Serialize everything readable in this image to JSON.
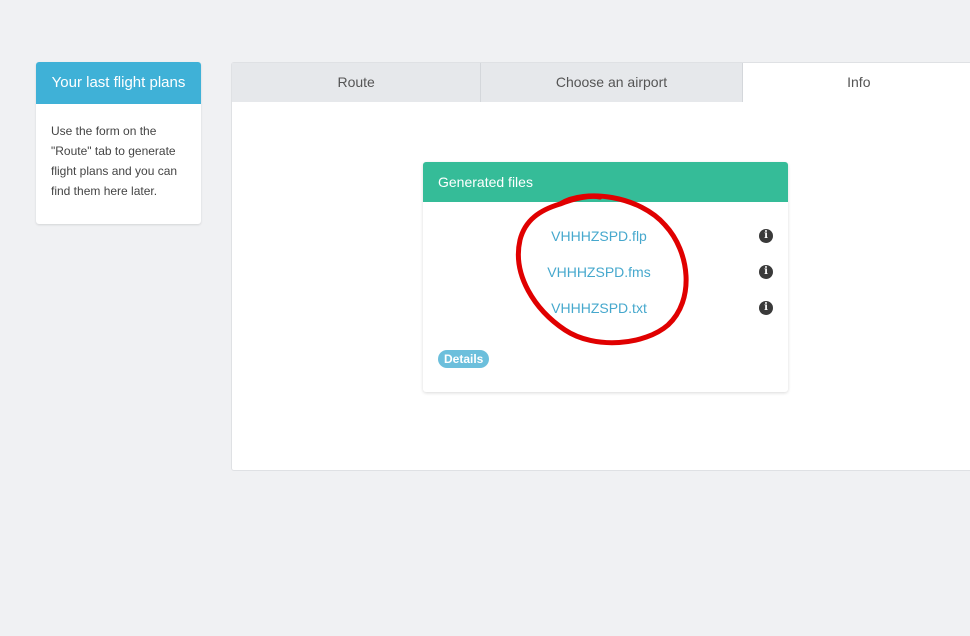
{
  "sidebar": {
    "title": "Your last flight plans",
    "description": "Use the form on the \"Route\" tab to generate flight plans and you can find them here later."
  },
  "tabs": [
    {
      "label": "Route",
      "active": false
    },
    {
      "label": "Choose an airport",
      "active": false
    },
    {
      "label": "Info",
      "active": true
    }
  ],
  "generated_files": {
    "title": "Generated files",
    "files": [
      {
        "name": "VHHHZSPD.flp",
        "icon": "info-circle-icon"
      },
      {
        "name": "VHHHZSPD.fms",
        "icon": "info-circle-icon"
      },
      {
        "name": "VHHHZSPD.txt",
        "icon": "info-circle-icon"
      }
    ],
    "details_label": "Details"
  },
  "colors": {
    "sidebar_header": "#3fb1d7",
    "files_header": "#35bc98",
    "link": "#46a8cd",
    "badge": "#6cbfdc",
    "annotation": "#e00000"
  }
}
